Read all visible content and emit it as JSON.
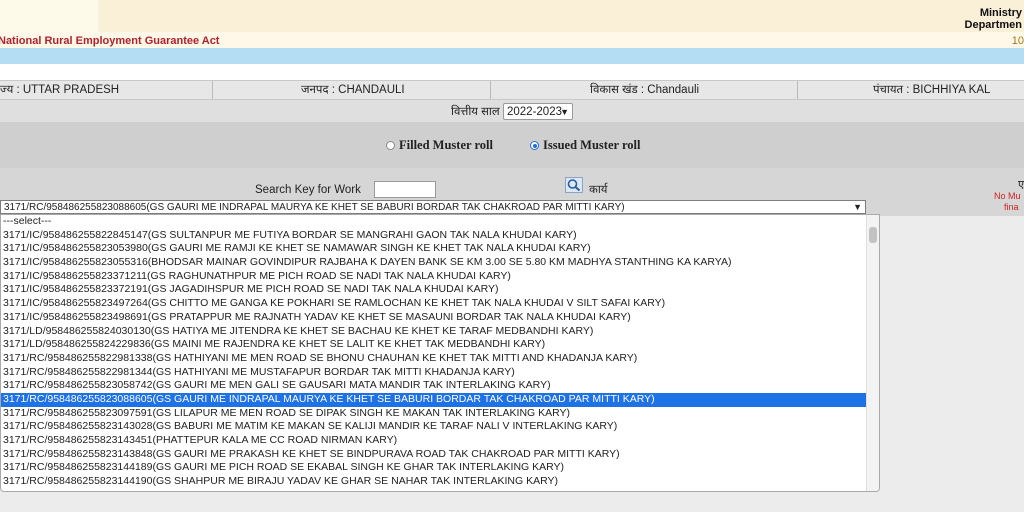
{
  "header": {
    "ministry_line1": "Ministry",
    "ministry_line2": "Departmen",
    "act_title": "National Rural Employment Guarantee Act",
    "act_num": "10"
  },
  "location": {
    "state": "ज्य : UTTAR PRADESH",
    "district": "जनपद : CHANDAULI",
    "block": "विकास खंड : Chandauli",
    "panchayat": "पंचायत : BICHHIYA KAL"
  },
  "financial_year": {
    "label": "वित्तीय साल",
    "value": "2022-2023"
  },
  "muster": {
    "filled_label": "Filled Muster roll",
    "issued_label": "Issued Muster roll",
    "selected": "issued"
  },
  "search": {
    "label": "Search Key for Work",
    "value": "",
    "karya_label": "कार्य"
  },
  "right_note": {
    "line0": "ए",
    "line1": "No Mu",
    "line2": "fina"
  },
  "work_select": {
    "value": "3171/RC/958486255823088605(GS GAURI ME INDRAPAL MAURYA KE KHET SE BABURI BORDAR TAK CHAKROAD PAR MITTI KARY)",
    "options": [
      "---select---",
      "3171/IC/958486255822845147(GS SULTANPUR ME FUTIYA BORDAR SE MANGRAHI GAON TAK NALA KHUDAI KARY)",
      "3171/IC/958486255823053980(GS GAURI ME RAMJI KE KHET SE NAMAWAR SINGH KE KHET TAK NALA KHUDAI KARY)",
      "3171/IC/958486255823055316(BHODSAR MAINAR GOVINDIPUR RAJBAHA K DAYEN BANK SE KM 3.00 SE 5.80 KM MADHYA STANTHING KA KARYA)",
      "3171/IC/958486255823371211(GS RAGHUNATHPUR ME PICH ROAD SE NADI TAK NALA KHUDAI KARY)",
      "3171/IC/958486255823372191(GS JAGADIHSPUR ME PICH ROAD SE NADI TAK NALA KHUDAI KARY)",
      "3171/IC/958486255823497264(GS CHITTO ME GANGA KE POKHARI SE RAMLOCHAN KE KHET TAK NALA KHUDAI V SILT SAFAI KARY)",
      "3171/IC/958486255823498691(GS PRATAPPUR ME RAJNATH YADAV KE KHET SE MASAUNI BORDAR TAK NALA KHUDAI KARY)",
      "3171/LD/958486255824030130(GS HATIYA ME JITENDRA KE KHET SE BACHAU KE KHET KE TARAF MEDBANDHI KARY)",
      "3171/LD/958486255824229836(GS MAINI ME RAJENDRA KE KHET SE LALIT KE KHET TAK MEDBANDHI KARY)",
      "3171/RC/958486255822981338(GS HATHIYANI ME MEN ROAD SE BHONU CHAUHAN KE KHET TAK MITTI AND KHADANJA KARY)",
      "3171/RC/958486255822981344(GS HATHIYANI ME MUSTAFAPUR BORDAR TAK MITTI KHADANJA KARY)",
      "3171/RC/958486255823058742(GS GAURI ME MEN GALI SE GAUSARI MATA MANDIR TAK INTERLAKING KARY)",
      "3171/RC/958486255823088605(GS GAURI ME INDRAPAL MAURYA KE KHET SE BABURI BORDAR TAK CHAKROAD PAR MITTI KARY)",
      "3171/RC/958486255823097591(GS LILAPUR ME MEN ROAD SE DIPAK SINGH KE MAKAN TAK INTERLAKING KARY)",
      "3171/RC/958486255823143028(GS BABURI ME MATIM KE MAKAN SE KALIJI MANDIR KE TARAF NALI V INTERLAKING KARY)",
      "3171/RC/958486255823143451(PHATTEPUR KALA ME CC ROAD NIRMAN KARY)",
      "3171/RC/958486255823143848(GS GAURI ME PRAKASH KE KHET SE BINDPURAVA ROAD TAK CHAKROAD PAR MITTI KARY)",
      "3171/RC/958486255823144189(GS GAURI ME PICH ROAD SE EKABAL SINGH KE GHAR TAK INTERLAKING KARY)",
      "3171/RC/958486255823144190(GS SHAHPUR ME BIRAJU YADAV KE GHAR SE NAHAR TAK INTERLAKING KARY)"
    ],
    "selected_index": 13
  },
  "colors": {
    "selection": "#1e72e6",
    "act_title": "#b0222b",
    "header_band": "#faefd7",
    "blue_strip": "#b4dcf3"
  }
}
